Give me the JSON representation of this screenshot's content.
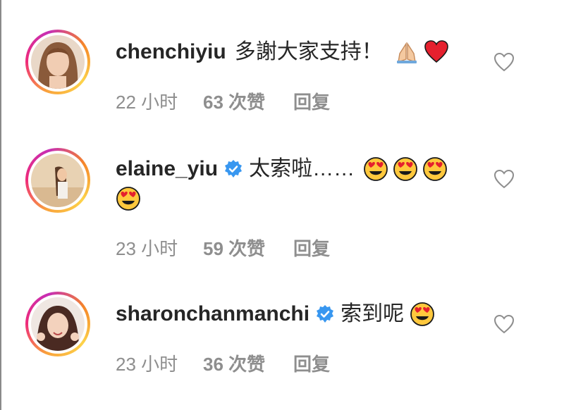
{
  "comments": [
    {
      "username": "chenchiyiu",
      "verified": false,
      "text": "多謝大家支持！",
      "emojis": [
        "folded-hands",
        "red-heart"
      ],
      "time": "22 小时",
      "likes": "63 次赞",
      "reply": "回复"
    },
    {
      "username": "elaine_yiu",
      "verified": true,
      "text": "太索啦……",
      "emojis": [
        "heart-eyes",
        "heart-eyes",
        "heart-eyes",
        "heart-eyes"
      ],
      "time": "23 小时",
      "likes": "59 次赞",
      "reply": "回复"
    },
    {
      "username": "sharonchanmanchi",
      "verified": true,
      "text": "索到呢",
      "emojis": [
        "heart-eyes"
      ],
      "time": "23 小时",
      "likes": "36 次赞",
      "reply": "回复"
    }
  ],
  "colors": {
    "username": "#262626",
    "meta": "#8e8e8e",
    "verified_badge": "#3897f0",
    "story_ring": "#ee2a7b"
  },
  "icons": [
    "heart-outline-icon",
    "verified-badge-icon"
  ]
}
